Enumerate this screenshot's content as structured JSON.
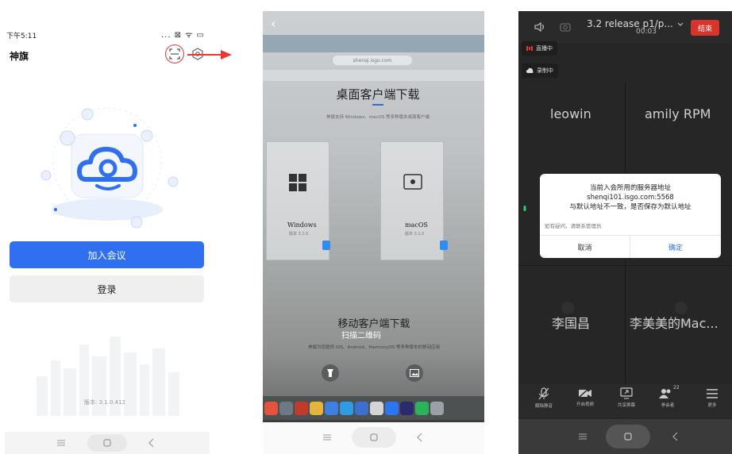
{
  "phone1": {
    "status_time": "下午5:11",
    "status_icons": "... ⊠ ᯤ ▭",
    "app_title": "神旗",
    "join_label": "加入会议",
    "login_label": "登录",
    "version": "版本: 3.1.0.412",
    "accent_color": "#2f6ff0"
  },
  "phone2": {
    "url": "shenqi.isgo.com",
    "desktop_title": "桌面客户端下载",
    "desktop_desc": "神旗支持 Windows、macOS 等多种版本桌面客户端",
    "windows_label": "Windows",
    "windows_version": "版本 3.1.0",
    "mac_label": "macOS",
    "mac_version": "版本 3.1.0",
    "mobile_title": "移动客户端下载",
    "scan_label": "扫描二维码",
    "mobile_desc": "神旗为您提供 iOS、Android、HarmonyOS 等多种版本的移动应用"
  },
  "phone3": {
    "meeting_title": "3.2 release p1/p...",
    "meeting_time": "00:03",
    "end_label": "结束",
    "live_label": "直播中",
    "record_label": "录制中",
    "participants": [
      "leowin",
      "amily RPM",
      "李国昌",
      "李美美的Mac..."
    ],
    "dialog": {
      "line1": "当前入会所用的服务器地址",
      "line2": "shenqi101.isgo.com:5568",
      "line3": "与默认地址不一致，是否保存为默认地址",
      "hint": "如有疑问，请联系管理员",
      "cancel": "取消",
      "ok": "确定"
    },
    "toolbar": {
      "unmute": "解除静音",
      "video": "开启视频",
      "share": "共享屏幕",
      "participants": "参会者",
      "participant_count": "22",
      "more": "更多"
    }
  }
}
